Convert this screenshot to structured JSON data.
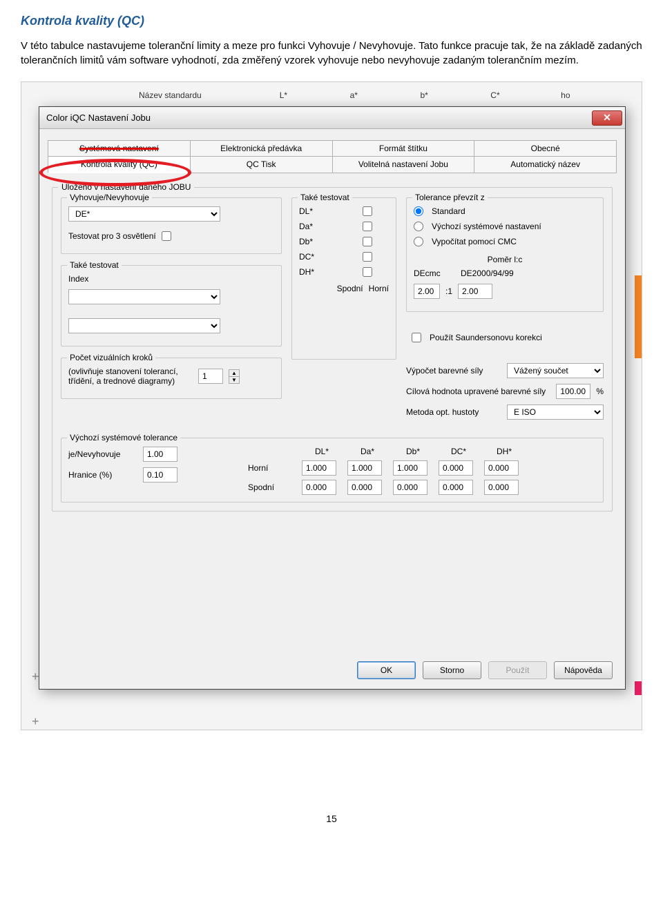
{
  "doc": {
    "heading": "Kontrola kvality (QC)",
    "paragraph": "V této tabulce nastavujeme toleranční limity a meze pro funkci Vyhovuje / Nevyhovuje. Tato funkce pracuje tak, že na základě zadaných tolerančních limitů vám software vyhodnotí, zda změřený vzorek vyhovuje nebo nevyhovuje zadaným tolerančním mezím.",
    "page_number": "15"
  },
  "columns_hint": {
    "c0": "Název standardu",
    "c1": "L*",
    "c2": "a*",
    "c3": "b*",
    "c4": "C*",
    "c5": "ho"
  },
  "dialog": {
    "title": "Color iQC Nastavení Jobu",
    "close_glyph": "✕",
    "tabs_top": [
      "Systémová nastavení",
      "Elektronická předávka",
      "Formát štítku",
      "Obecné"
    ],
    "tabs_bottom": [
      "Kontrola kvality (QC)",
      "QC Tisk",
      "Volitelná nastavení Jobu",
      "Automatický název"
    ],
    "group_saved": "Uloženo v nastavení daného JOBU",
    "group_pass_fail": "Vyhovuje/Nevyhovuje",
    "de_select": "DE*",
    "test3light": "Testovat pro 3 osvětlení",
    "group_also_test": "Také testovat",
    "also_rows": [
      "DL*",
      "Da*",
      "Db*",
      "DC*",
      "DH*"
    ],
    "also_cols": {
      "lower": "Spodní",
      "upper": "Horní"
    },
    "group_also_test2": "Také testovat",
    "also_index": "Index",
    "group_tol_from": "Tolerance převzít z",
    "tol_from_options": [
      "Standard",
      "Výchozí systémové nastavení",
      "Vypočítat pomocí CMC"
    ],
    "ratio_label": "Poměr l:c",
    "decmc": "DEcmc",
    "de2000": "DE2000/94/99",
    "ratio_val": "2.00",
    "ratio_sep": ":1",
    "de2000_val": "2.00",
    "use_saunderson": "Použít Saundersonovu korekci",
    "group_visualsteps": "Počet vizuálních kroků",
    "visualsteps_hint": "(ovlivňuje stanovení tolerancí, třídění, a trednové diagramy)",
    "visualsteps_val": "1",
    "calc_strength_label": "Výpočet barevné síly",
    "calc_strength_val": "Vážený součet",
    "target_strength_label": "Cílová hodnota upravené barevné síly",
    "target_strength_val": "100.00",
    "percent": "%",
    "opt_density_label": "Metoda opt. hustoty",
    "opt_density_val": "E ISO",
    "group_systol": "Výchozí systémové tolerance",
    "systol_passfail_label": "je/Nevyhovuje",
    "systol_passfail_val": "1.00",
    "systol_border_label": "Hranice (%)",
    "systol_border_val": "0.10",
    "systol_headers": [
      "DL*",
      "Da*",
      "Db*",
      "DC*",
      "DH*"
    ],
    "systol_upper_label": "Horní",
    "systol_upper": [
      "1.000",
      "1.000",
      "1.000",
      "0.000",
      "0.000"
    ],
    "systol_lower_label": "Spodní",
    "systol_lower": [
      "0.000",
      "0.000",
      "0.000",
      "0.000",
      "0.000"
    ],
    "btn_ok": "OK",
    "btn_cancel": "Storno",
    "btn_apply": "Použít",
    "btn_help": "Nápověda"
  }
}
